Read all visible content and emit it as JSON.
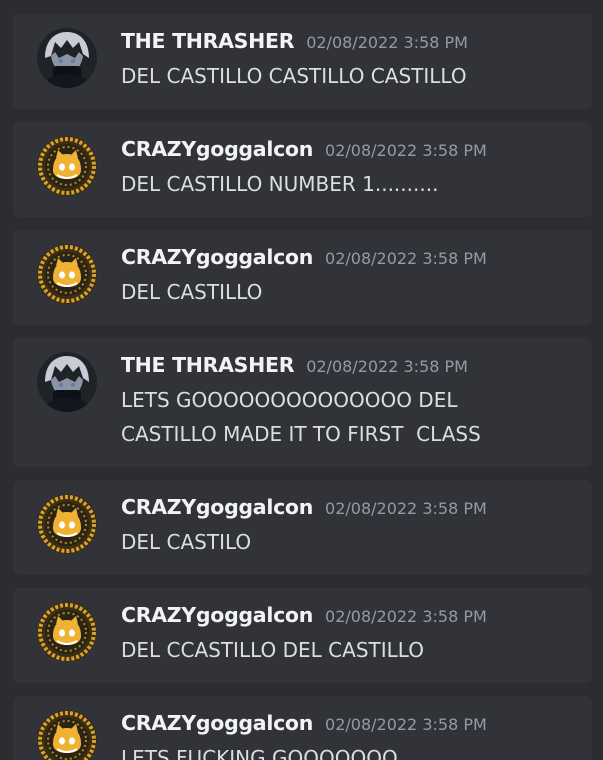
{
  "messages": [
    {
      "author": "THE THRASHER",
      "avatar": "anime-character-avatar",
      "timestamp": "02/08/2022 3:58 PM",
      "lines": [
        "DEL CASTILLO CASTILLO CASTILLO"
      ]
    },
    {
      "author": "CRAZYgoggalcon",
      "avatar": "yellow-discord-avatar",
      "timestamp": "02/08/2022 3:58 PM",
      "lines": [
        "DEL CASTILLO NUMBER 1.........."
      ]
    },
    {
      "author": "CRAZYgoggalcon",
      "avatar": "yellow-discord-avatar",
      "timestamp": "02/08/2022 3:58 PM",
      "lines": [
        "DEL CASTILLO"
      ]
    },
    {
      "author": "THE THRASHER",
      "avatar": "anime-character-avatar",
      "timestamp": "02/08/2022 3:58 PM",
      "lines": [
        "LETS GOOOOOOOOOOOOOO DEL",
        "CASTILLO MADE IT TO FIRST  CLASS"
      ]
    },
    {
      "author": "CRAZYgoggalcon",
      "avatar": "yellow-discord-avatar",
      "timestamp": "02/08/2022 3:58 PM",
      "lines": [
        "DEL CASTILO"
      ]
    },
    {
      "author": "CRAZYgoggalcon",
      "avatar": "yellow-discord-avatar",
      "timestamp": "02/08/2022 3:58 PM",
      "lines": [
        "DEL CCASTILLO DEL CASTILLO"
      ]
    },
    {
      "author": "CRAZYgoggalcon",
      "avatar": "yellow-discord-avatar",
      "timestamp": "02/08/2022 3:58 PM",
      "lines": [
        "LETS FUCKING GOOOOOOO"
      ]
    }
  ],
  "colors": {
    "background": "#2b2d31",
    "card": "#313338",
    "username": "#f2f3f5",
    "timestamp": "#949ba4",
    "text": "#dbdee1",
    "yellow_avatar": "#f0b232"
  }
}
